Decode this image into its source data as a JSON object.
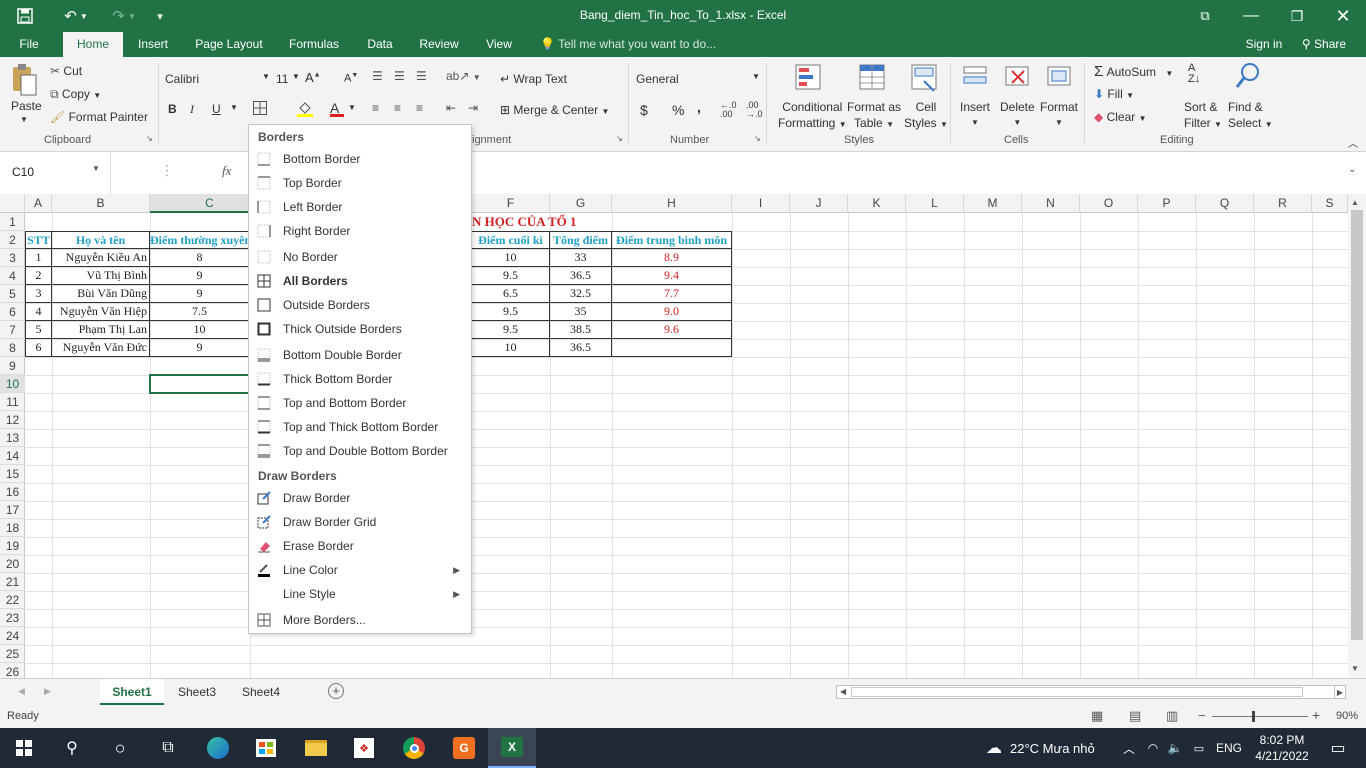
{
  "window": {
    "title": "Bang_diem_Tin_hoc_To_1.xlsx - Excel"
  },
  "quick_access": {
    "save": "save-icon",
    "undo": "undo-icon",
    "redo": "redo-icon",
    "customize": "customize-qat-icon"
  },
  "tabs": [
    "File",
    "Home",
    "Insert",
    "Page Layout",
    "Formulas",
    "Data",
    "Review",
    "View"
  ],
  "active_tab": "Home",
  "tell_me": "Tell me what you want to do...",
  "account": {
    "sign_in": "Sign in",
    "share": "Share"
  },
  "ribbon": {
    "clipboard": {
      "paste": "Paste",
      "cut": "Cut",
      "copy": "Copy",
      "format_painter": "Format Painter",
      "group": "Clipboard"
    },
    "font": {
      "name": "Calibri",
      "size": "11",
      "bold": "B",
      "italic": "I",
      "underline": "U",
      "group": "F"
    },
    "alignment": {
      "wrap_text": "Wrap Text",
      "merge_center": "Merge & Center",
      "group": "ignment"
    },
    "number": {
      "format": "General",
      "currency": "$",
      "percent": "%",
      "comma": ",",
      "group": "Number"
    },
    "styles": {
      "conditional_formatting": [
        "Conditional",
        "Formatting"
      ],
      "format_as_table": [
        "Format as",
        "Table"
      ],
      "cell_styles": [
        "Cell",
        "Styles"
      ],
      "group": "Styles"
    },
    "cells": {
      "insert": "Insert",
      "delete": "Delete",
      "format": "Format",
      "group": "Cells"
    },
    "editing": {
      "autosum": "AutoSum",
      "fill": "Fill",
      "clear": "Clear",
      "sort_filter": [
        "Sort &",
        "Filter"
      ],
      "find_select": [
        "Find &",
        "Select"
      ],
      "group": "Editing"
    }
  },
  "formula_bar": {
    "name_box": "C10",
    "fx": "fx",
    "value": ""
  },
  "columns": [
    "A",
    "B",
    "C",
    "F",
    "G",
    "H",
    "I",
    "J",
    "K",
    "L",
    "M",
    "N",
    "O",
    "P",
    "Q",
    "R",
    "S"
  ],
  "rows": [
    "1",
    "2",
    "3",
    "4",
    "5",
    "6",
    "7",
    "8",
    "9",
    "10",
    "11",
    "12",
    "13",
    "14",
    "15",
    "16",
    "17",
    "18",
    "19",
    "20",
    "21",
    "22",
    "23",
    "24",
    "25",
    "26"
  ],
  "sheet": {
    "title_fragment": "N HỌC CỦA TỔ 1",
    "headers": {
      "stt": "STT",
      "name": "Họ và tên",
      "regular": "Điểm thường xuyên",
      "final": "Điểm cuối kì",
      "total": "Tổng điểm",
      "average": "Điểm trung bình môn"
    },
    "records": [
      {
        "stt": "1",
        "name": "Nguyễn Kiều An",
        "regular": "8",
        "final": "10",
        "total": "33",
        "average": "8.9"
      },
      {
        "stt": "2",
        "name": "Vũ Thị Bình",
        "regular": "9",
        "final": "9.5",
        "total": "36.5",
        "average": "9.4"
      },
      {
        "stt": "3",
        "name": "Bùi Văn Dũng",
        "regular": "9",
        "final": "6.5",
        "total": "32.5",
        "average": "7.7"
      },
      {
        "stt": "4",
        "name": "Nguyễn Văn Hiệp",
        "regular": "7.5",
        "final": "9.5",
        "total": "35",
        "average": "9.0"
      },
      {
        "stt": "5",
        "name": "Phạm Thị Lan",
        "regular": "10",
        "final": "9.5",
        "total": "38.5",
        "average": "9.6"
      },
      {
        "stt": "6",
        "name": "Nguyễn Văn Đức",
        "regular": "9",
        "final": "10",
        "total": "36.5",
        "average": ""
      }
    ]
  },
  "borders_menu": {
    "title": "Borders",
    "items": [
      "Bottom Border",
      "Top Border",
      "Left Border",
      "Right Border",
      "No Border",
      "All Borders",
      "Outside Borders",
      "Thick Outside Borders",
      "Bottom Double Border",
      "Thick Bottom Border",
      "Top and Bottom Border",
      "Top and Thick Bottom Border",
      "Top and Double Bottom Border"
    ],
    "draw_title": "Draw Borders",
    "draw_items": [
      "Draw Border",
      "Draw Border Grid",
      "Erase Border",
      "Line Color",
      "Line Style",
      "More Borders..."
    ]
  },
  "sheet_tabs": [
    "Sheet1",
    "Sheet3",
    "Sheet4"
  ],
  "active_sheet": "Sheet1",
  "status": {
    "text": "Ready",
    "zoom": "90%"
  },
  "taskbar": {
    "weather": "22°C  Mưa nhỏ",
    "lang": "ENG",
    "time": "8:02 PM",
    "date": "4/21/2022"
  },
  "colors": {
    "accent": "#217346",
    "header_text": "#1fa0c8",
    "red_text": "#d42020"
  }
}
